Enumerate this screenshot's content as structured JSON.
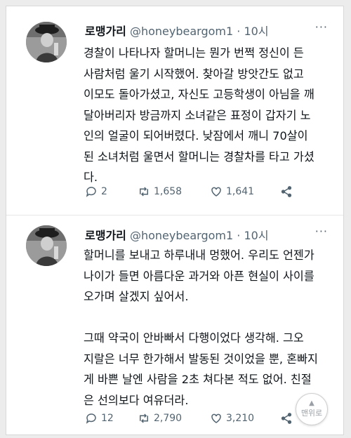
{
  "tweets": [
    {
      "name": "로맹가리",
      "handle": "@honeybeargom1",
      "dot": "·",
      "time": "10시",
      "lines": [
        "경찰이 나타나자 할머니는 뭔가 번쩍 정신이 든",
        "사람처럼 울기 시작했어. 찾아갈 방앗간도 없고",
        "이모도 돌아가셨고, 자신도 고등학생이 아님을 깨",
        "달아버리자 방금까지 소녀같은 표정이 갑자기 노",
        "인의 얼굴이 되어버렸다. 낮잠에서 깨니 70살이",
        "된 소녀처럼 울면서 할머니는 경찰차를 타고 가셨",
        "다."
      ],
      "replies": "2",
      "retweets": "1,658",
      "likes": "1,641"
    },
    {
      "name": "로맹가리",
      "handle": "@honeybeargom1",
      "dot": "·",
      "time": "10시",
      "lines": [
        "할머니를 보내고 하루내내 멍했어. 우리도 언젠가",
        "나이가 들면 아름다운 과거와 아픈 현실이 사이를",
        "오가며 살겠지 싶어서.",
        "",
        "그때 약국이 안바빠서 다행이었다 생각해. 그오",
        "지랄은 너무 한가해서 발동된 것이었을 뿐, 혼빠지",
        "게 바쁜 날엔 사람을 2초 쳐다본 적도 없어. 친절",
        "은 선의보다 여유더라."
      ],
      "replies": "12",
      "retweets": "2,790",
      "likes": "3,210"
    }
  ],
  "scroll_top_label": "맨위로",
  "colors": {
    "text": "#0f1419",
    "secondary": "#536471",
    "background": "#ffffff"
  },
  "icons": [
    "reply-icon",
    "retweet-icon",
    "like-icon",
    "share-icon",
    "more-icon"
  ]
}
